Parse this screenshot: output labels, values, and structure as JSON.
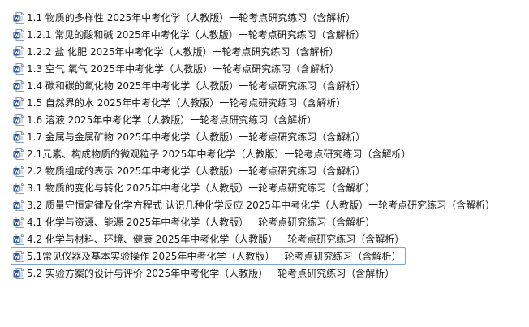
{
  "files": [
    {
      "name": "1.1 物质的多样性  2025年中考化学（人教版）一轮考点研究练习（含解析）",
      "icon": "word-document-icon",
      "selected": false
    },
    {
      "name": "1.2.1 常见的酸和碱  2025年中考化学（人教版）一轮考点研究练习（含解析）",
      "icon": "word-document-icon",
      "selected": false
    },
    {
      "name": "1.2.2 盐 化肥  2025年中考化学（人教版）一轮考点研究练习（含解析）",
      "icon": "word-document-icon",
      "selected": false
    },
    {
      "name": "1.3 空气 氧气  2025年中考化学（人教版）一轮考点研究练习（含解析）",
      "icon": "word-document-icon",
      "selected": false
    },
    {
      "name": "1.4 碳和碳的氧化物  2025年中考化学（人教版）一轮考点研究练习（含解析）",
      "icon": "word-document-icon",
      "selected": false
    },
    {
      "name": "1.5 自然界的水  2025年中考化学（人教版）一轮考点研究练习（含解析）",
      "icon": "word-document-icon",
      "selected": false
    },
    {
      "name": "1.6 溶液  2025年中考化学（人教版）一轮考点研究练习（含解析）",
      "icon": "word-document-icon",
      "selected": false
    },
    {
      "name": "1.7 金属与金属矿物  2025年中考化学（人教版）一轮考点研究练习（含解析）",
      "icon": "word-document-icon",
      "selected": false
    },
    {
      "name": "2.1元素、构成物质的微观粒子  2025年中考化学（人教版）一轮考点研究练习（含解析）",
      "icon": "word-document-icon",
      "selected": false
    },
    {
      "name": "2.2 物质组成的表示  2025年中考化学（人教版）一轮考点研究练习（含解析）",
      "icon": "word-document-icon",
      "selected": false
    },
    {
      "name": "3.1 物质的变化与转化  2025年中考化学（人教版）一轮考点研究练习（含解析）",
      "icon": "word-document-icon",
      "selected": false
    },
    {
      "name": "3.2 质量守恒定律及化学方程式 认识几种化学反应  2025年中考化学（人教版）一轮考点研究练习（含解析）",
      "icon": "word-document-icon",
      "selected": false
    },
    {
      "name": "4.1 化学与资源、能源  2025年中考化学（人教版）一轮考点研究练习（含解析）",
      "icon": "word-document-icon",
      "selected": false
    },
    {
      "name": "4.2 化学与材料、环境、健康  2025年中考化学（人教版）一轮考点研究练习（含解析）",
      "icon": "word-document-icon",
      "selected": false
    },
    {
      "name": "5.1常见仪器及基本实验操作  2025年中考化学（人教版）一轮考点研究练习（含解析）",
      "icon": "word-document-icon",
      "selected": true
    },
    {
      "name": "5.2 实验方案的设计与评价  2025年中考化学（人教版）一轮考点研究练习（含解析）",
      "icon": "word-document-icon",
      "selected": false
    }
  ],
  "colors": {
    "icon_blue": "#2b579a",
    "icon_paper": "#ffffff",
    "selection_border": "#7da2ce",
    "text": "#1a1a1a"
  }
}
